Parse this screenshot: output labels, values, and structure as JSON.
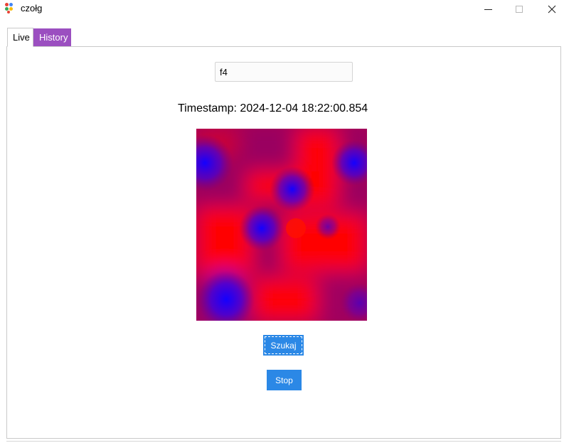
{
  "window": {
    "title": "czołg",
    "icon": "app-dots-icon",
    "controls": [
      "minimize-icon",
      "maximize-icon",
      "close-icon"
    ]
  },
  "tabs": [
    {
      "label": "Live",
      "active": true
    },
    {
      "label": "History",
      "active": false,
      "color": "#9b4fc0"
    }
  ],
  "live": {
    "search": {
      "value": "f4",
      "placeholder": ""
    },
    "timestamp": "Timestamp: 2024-12-04 18:22:00.854",
    "heatmap": {
      "colors": {
        "low": "#1a00ff",
        "high": "#ff0000"
      }
    },
    "buttons": {
      "search_label": "Szukaj",
      "stop_label": "Stop"
    }
  },
  "colors": {
    "button_bg": "#2b88e6",
    "history_tab_bg": "#9b4fc0"
  }
}
